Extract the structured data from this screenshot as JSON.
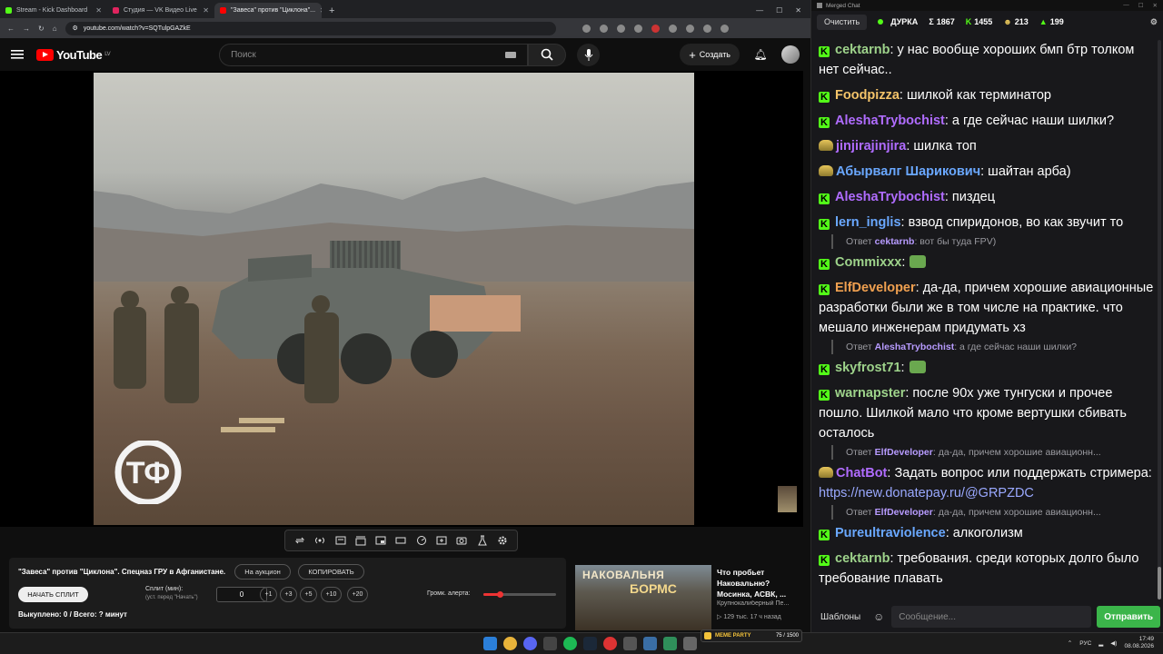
{
  "browser": {
    "tabs": [
      {
        "title": "Stream - Kick Dashboard",
        "color": "#53fc18"
      },
      {
        "title": "Студия — VK Видео Live",
        "color": "#e0245e"
      },
      {
        "title": "\"Завеса\" против \"Циклона\"...",
        "color": "#ff0000"
      }
    ],
    "url": "youtube.com/watch?v=SQTulpGAZkE",
    "new_tab": "+"
  },
  "youtube": {
    "logo": "YouTube",
    "region": "LV",
    "search_placeholder": "Поиск",
    "create_label": "Создать"
  },
  "video": {
    "channel_logo": "ТФ"
  },
  "panel": {
    "title": "\"Завеса\" против \"Циклона\". Спецназ ГРУ в Афганистане.",
    "auction": "На аукцион",
    "copy": "КОПИРОВАТЬ",
    "start_split": "НАЧАТЬ СПЛИТ",
    "split_label": "Сплит (мин):",
    "split_sub": "(уст. перед \"Начать\")",
    "split_value": "0",
    "increments": [
      "+1",
      "+3",
      "+5",
      "+10",
      "+20"
    ],
    "volume_label": "Громк. алерта:",
    "volume_fraction": 0.22,
    "sold": "Выкуплено: 0 / Всего: ? минут"
  },
  "recommendation": {
    "thumb_line1": "НАКОВАЛЬНЯ",
    "thumb_line2": "БОРМС",
    "title": "Что пробьет Наковальню? Мосинка, АСВК, ...",
    "channel": "Крупнокалиберный Пе...",
    "meta": "▷ 129 тыс.   17 ч назад",
    "meme_label": "MEME PARTY",
    "meme_count": "75 / 1500"
  },
  "chat": {
    "window_title": "Merged Chat",
    "clear": "Очистить",
    "channel": "ДУРКА",
    "stats": [
      {
        "icon": "Σ",
        "value": "1867"
      },
      {
        "icon": "K",
        "value": "1455"
      },
      {
        "icon": "☻",
        "value": "213"
      },
      {
        "icon": "▲",
        "value": "199"
      }
    ],
    "messages": [
      {
        "nick": "cektarnb",
        "color": "#9ed38b",
        "badge": "kick",
        "text": ": у нас вообще хороших бмп бтр толком нет сейчас.."
      },
      {
        "nick": "Foodpizza",
        "color": "#f5c46a",
        "badge": "kick",
        "text": ": шилкой как терминатор"
      },
      {
        "nick": "AleshaTrybochist",
        "color": "#b06cff",
        "badge": "kick",
        "text": ": а где сейчас наши шилки?"
      },
      {
        "nick": "jinjirajinjira",
        "color": "#b06cff",
        "badge": "vk",
        "text": ": шилка топ"
      },
      {
        "nick": "Абырвалг Шарикович",
        "color": "#6aa8ff",
        "badge": "vk",
        "text": ": шайтан арба)"
      },
      {
        "nick": "AleshaTrybochist",
        "color": "#b06cff",
        "badge": "kick",
        "text": ": пиздец"
      },
      {
        "nick": "lern_inglis",
        "color": "#6aa8ff",
        "badge": "kick",
        "text": ": взвод спиридонов, во как звучит то"
      },
      {
        "nick": "Commixxx",
        "color": "#9ed38b",
        "badge": "kick",
        "text": ":",
        "sticker": true,
        "reply_nick": "cektarnb",
        "reply_text": ": вот бы туда FPV)"
      },
      {
        "nick": "ElfDeveloper",
        "color": "#f0a050",
        "badge": "kick",
        "text": ": да-да, причем хорошие авиационные разработки были же в том числе на практике. что мешало инженерам придумать хз"
      },
      {
        "nick": "skyfrost71",
        "color": "#9ed38b",
        "badge": "kick",
        "text": ":",
        "sticker": true,
        "reply_nick": "AleshaTrybochist",
        "reply_text": ": а где сейчас наши шилки?"
      },
      {
        "nick": "warnapster",
        "color": "#9ed38b",
        "badge": "kick",
        "text": ": после 90х уже тунгуски и прочее пошло. Шилкой мало что кроме вертушки сбивать осталось"
      },
      {
        "nick": "ChatBot",
        "color": "#b06cff",
        "badge": "vk",
        "text": ": Задать вопрос или поддержать стримера: ",
        "link": "https://new.donatepay.ru/@GRPZDC",
        "reply_nick": "ElfDeveloper",
        "reply_text": ": да-да, причем хорошие авиационн..."
      },
      {
        "nick": "Pureultraviolence",
        "color": "#6aa8ff",
        "badge": "kick",
        "text": ": алкоголизм",
        "reply_nick": "ElfDeveloper",
        "reply_text": ": да-да, причем хорошие авиационн..."
      },
      {
        "nick": "cektarnb",
        "color": "#9ed38b",
        "badge": "kick",
        "text": ": требования. среди которых долго было требование плавать"
      }
    ],
    "reply_prefix": "Ответ",
    "templates": "Шаблоны",
    "message_placeholder": "Сообщение...",
    "send": "Отправить"
  },
  "taskbar": {
    "lang": "РУС",
    "time": "17:49",
    "date": "08.08.2026"
  }
}
